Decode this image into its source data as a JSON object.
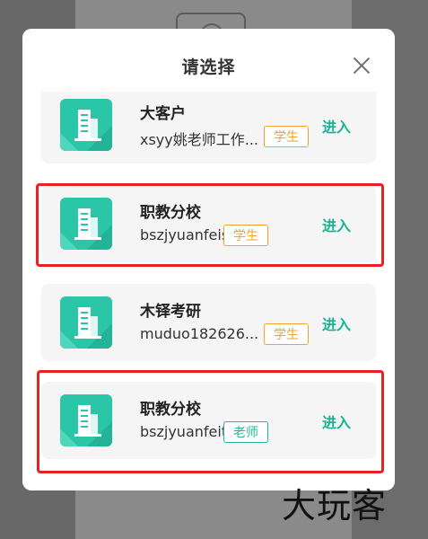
{
  "dialog": {
    "title": "请选择",
    "close_icon": "close-icon"
  },
  "accounts": [
    {
      "org": "大客户",
      "account": "xsyy姚老师工作...",
      "role": "学生",
      "role_type": "student",
      "action": "进入"
    },
    {
      "org": "职教分校",
      "account": "bszjyuanfeis",
      "role": "学生",
      "role_type": "student",
      "action": "进入"
    },
    {
      "org": "木铎考研",
      "account": "muduo182626...",
      "role": "学生",
      "role_type": "student",
      "action": "进入"
    },
    {
      "org": "职教分校",
      "account": "bszjyuanfeit",
      "role": "老师",
      "role_type": "teacher",
      "action": "进入"
    }
  ],
  "icon": "building-icon",
  "colors": {
    "accent": "#1bb394",
    "icon_bg": "#2bc6a7",
    "student_tag": "#f2a22a",
    "highlight": "#e8231f"
  },
  "watermark": "大玩客"
}
